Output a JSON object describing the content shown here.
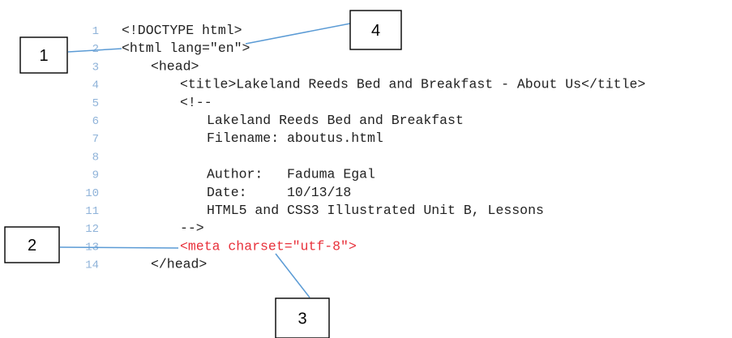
{
  "colors": {
    "line_number": "#8fb3d9",
    "code_text": "#222222",
    "highlight_text": "#e8313b",
    "leader_line": "#5b9bd5",
    "box_border": "#000000"
  },
  "code_lines": [
    {
      "num": "1",
      "text": "<!DOCTYPE html>",
      "highlight": false
    },
    {
      "num": "2",
      "text": "<html lang=\"en\">",
      "highlight": false
    },
    {
      "num": "3",
      "text": "<head>",
      "highlight": false
    },
    {
      "num": "4",
      "text": "<title>Lakeland Reeds Bed and Breakfast - About Us</title>",
      "highlight": false
    },
    {
      "num": "5",
      "text": "<!--",
      "highlight": false
    },
    {
      "num": "6",
      "text": "Lakeland Reeds Bed and Breakfast",
      "highlight": false
    },
    {
      "num": "7",
      "text": "Filename: aboutus.html",
      "highlight": false
    },
    {
      "num": "8",
      "text": "",
      "highlight": false
    },
    {
      "num": "9",
      "text": "Author:   Faduma Egal",
      "highlight": false
    },
    {
      "num": "10",
      "text": "Date:     10/13/18",
      "highlight": false
    },
    {
      "num": "11",
      "text": "HTML5 and CSS3 Illustrated Unit B, Lessons",
      "highlight": false
    },
    {
      "num": "12",
      "text": "-->",
      "highlight": false
    },
    {
      "num": "13",
      "text": "<meta charset=\"utf-8\">",
      "highlight": true
    },
    {
      "num": "14",
      "text": "</head>",
      "highlight": false
    }
  ],
  "callouts": [
    {
      "label": "1"
    },
    {
      "label": "2"
    },
    {
      "label": "3"
    },
    {
      "label": "4"
    }
  ]
}
